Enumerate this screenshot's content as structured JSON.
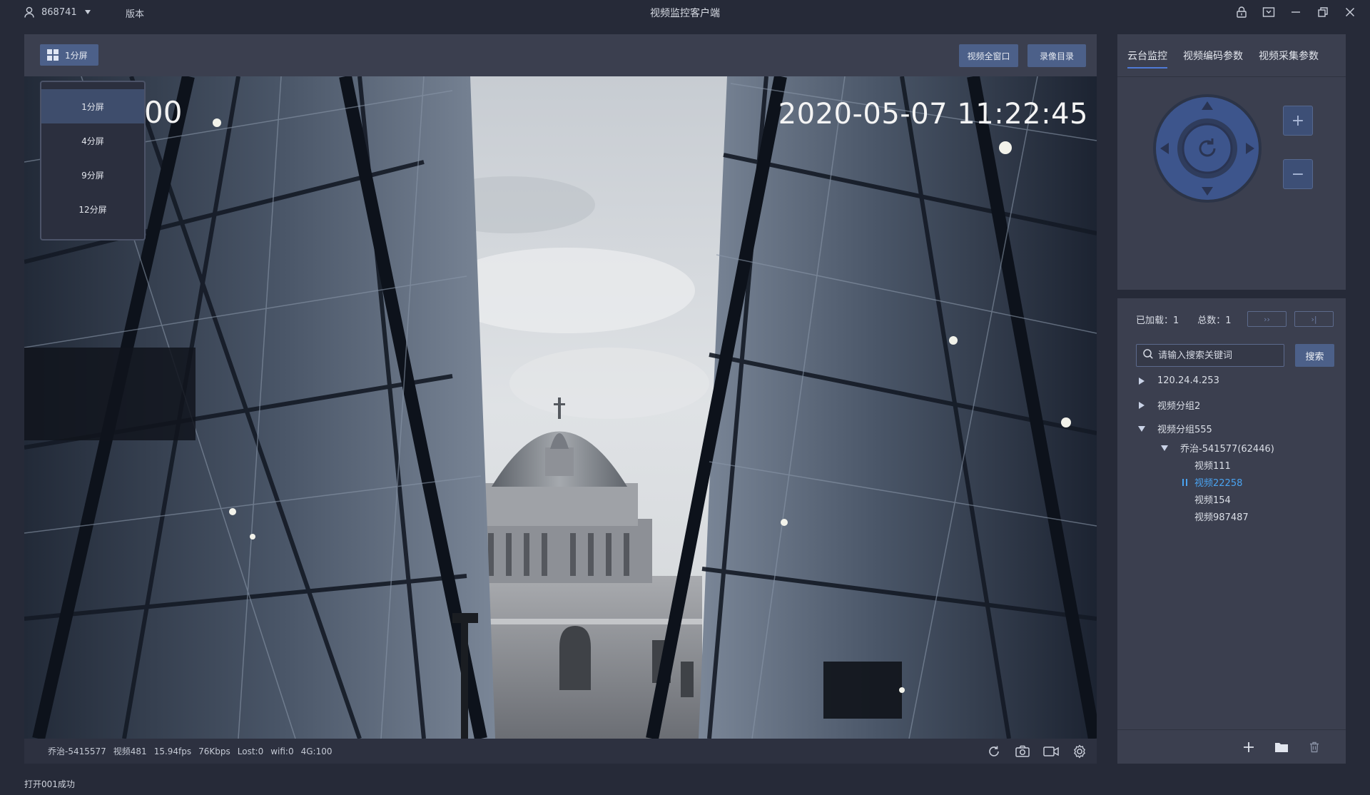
{
  "titlebar": {
    "user_id": "868741",
    "version_label": "版本",
    "app_title": "视频监控客户端"
  },
  "toolbar": {
    "layout_label": "1分屏",
    "fullscreen_label": "视频全窗口",
    "record_dir_label": "录像目录"
  },
  "layout_menu": {
    "options": [
      "1分屏",
      "4分屏",
      "9分屏",
      "12分屏"
    ],
    "selected_index": 0
  },
  "video": {
    "osd_left": "00",
    "osd_timestamp": "2020-05-07 11:22:45"
  },
  "video_status": {
    "device": "乔治-5415577",
    "channel": "视频481",
    "fps": "15.94fps",
    "bitrate": "76Kbps",
    "lost": "Lost:0",
    "wifi": "wifi:0",
    "signal": "4G:100"
  },
  "ptz": {
    "tabs": [
      "云台监控",
      "视频编码参数",
      "视频采集参数"
    ],
    "active_tab": 0,
    "zoom_in_label": "+",
    "zoom_out_label": "−"
  },
  "devices": {
    "loaded_label": "已加载：1",
    "total_label": "总数：1",
    "next_label": "››",
    "last_label": "›|",
    "search_placeholder": "请输入搜索关键词",
    "search_button": "搜索",
    "tree": [
      {
        "label": "120.24.4.253",
        "level": 0,
        "state": "collapsed"
      },
      {
        "label": "视频分组2",
        "level": 0,
        "state": "collapsed"
      },
      {
        "label": "视频分组555",
        "level": 0,
        "state": "expanded"
      },
      {
        "label": "乔治-541577(62446)",
        "level": 1,
        "state": "expanded"
      },
      {
        "label": "视频111",
        "level": 2,
        "state": "leaf"
      },
      {
        "label": "视频22258",
        "level": 2,
        "state": "playing"
      },
      {
        "label": "视频154",
        "level": 2,
        "state": "leaf"
      },
      {
        "label": "视频987487",
        "level": 2,
        "state": "leaf"
      }
    ]
  },
  "bottom_status": "打开001成功",
  "colors": {
    "background": "#262a38",
    "panel": "#3b3f4f",
    "accent_button": "#4c6089",
    "active_link": "#4aa3f0"
  }
}
